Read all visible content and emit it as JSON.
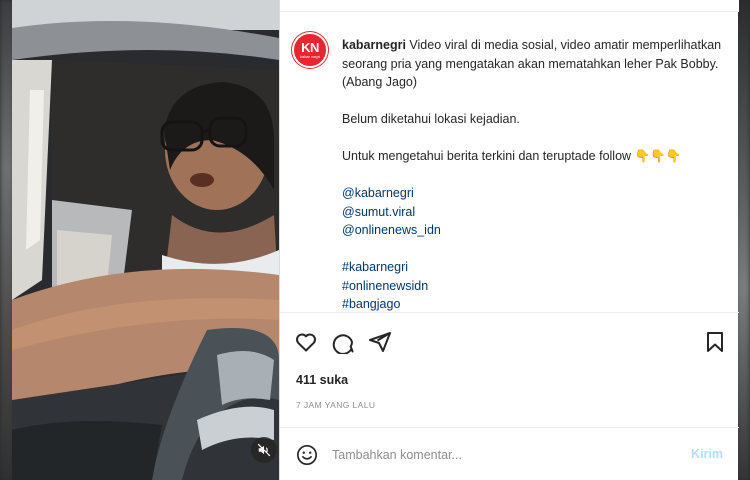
{
  "post": {
    "avatar_logo": "KN",
    "avatar_sub": "kabar negri",
    "username": "kabarnegri",
    "caption_first": "Video viral di media sosial, video amatir memperlihatkan seorang pria yang mengatakan akan mematahkan leher Pak Bobby. (Abang Jago)",
    "caption_second": "Belum diketahui lokasi kejadian.",
    "caption_third": "Untuk mengetahui berita terkini dan teruptade follow 👇👇👇",
    "mentions": [
      "@kabarnegri",
      "@sumut.viral",
      "@onlinenews_idn"
    ],
    "hashtags": [
      "#kabarnegri",
      "#onlinenewsidn",
      "#bangjago"
    ]
  },
  "actions": {
    "like_icon": "heart-icon",
    "comment_icon": "comment-icon",
    "share_icon": "share-icon",
    "save_icon": "bookmark-icon"
  },
  "stats": {
    "likes": "411 suka",
    "time": "7 JAM YANG LALU"
  },
  "comment": {
    "placeholder": "Tambahkan komentar...",
    "post_label": "Kirim",
    "emoji_icon": "smile-icon"
  },
  "video": {
    "mute_icon": "muted-speaker-icon"
  },
  "colors": {
    "brand_red": "#e8262f",
    "link": "#00376b",
    "post_disabled": "#b2dffc"
  }
}
